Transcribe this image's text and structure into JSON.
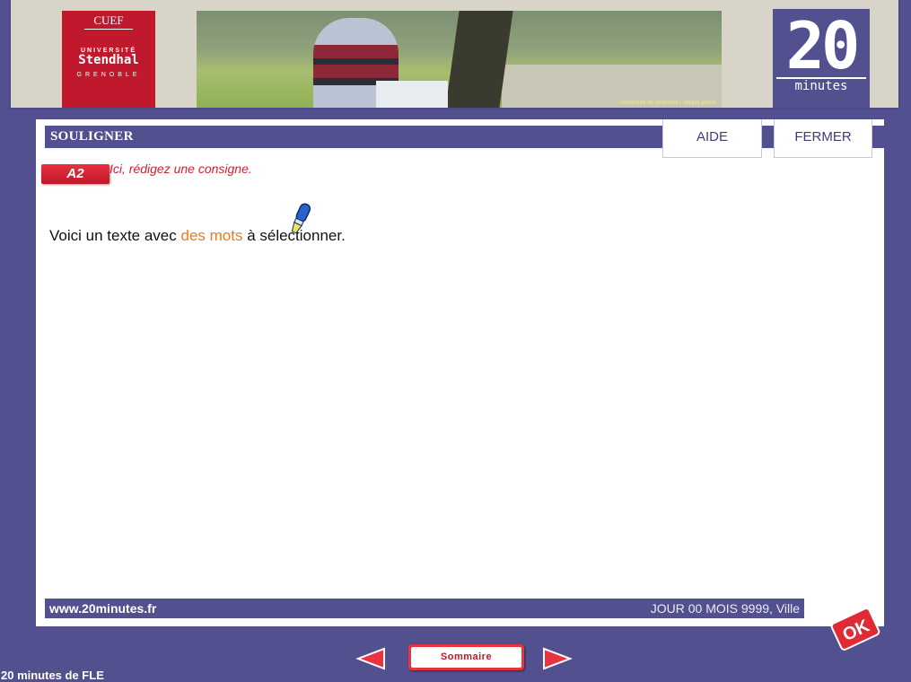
{
  "header": {
    "cuef_label": "CUEF",
    "univ_line1": "UNIVERSITÉ",
    "univ_line2": "Stendhal",
    "univ_line3": "GRENOBLE",
    "photo_caption": "Université de Grenoble / Utopik photo",
    "logo_number": "20",
    "logo_word": "minutes"
  },
  "exercise": {
    "title": "SOULIGNER",
    "level": "A2",
    "instruction": "Ici, rédigez une consigne.",
    "text_before": "Voici un texte avec ",
    "text_highlight": "des mots",
    "text_after": " à sélectionner."
  },
  "buttons": {
    "aide": "AIDE",
    "fermer": "FERMER",
    "ok": "OK",
    "sommaire": "Sommaire"
  },
  "footer": {
    "url": "www.20minutes.fr",
    "date_place": "JOUR 00 MOIS 9999, Ville"
  },
  "app_name": "20 minutes de FLE",
  "colors": {
    "primary": "#52508f",
    "accent_red": "#c0182c",
    "highlight_orange": "#f07a1a"
  }
}
